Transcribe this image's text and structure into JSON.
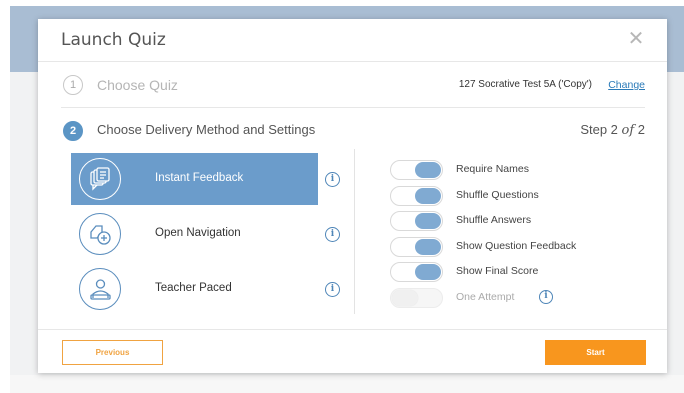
{
  "modal": {
    "title": "Launch Quiz",
    "close_icon": "close-icon"
  },
  "step1": {
    "number": "1",
    "label": "Choose Quiz",
    "quiz_name": "127 Socrative Test 5A ('Copy')",
    "change_link": "Change"
  },
  "step2": {
    "number": "2",
    "label": "Choose Delivery Method and Settings",
    "step_prefix": "Step 2 ",
    "step_of": "of",
    "step_suffix": " 2"
  },
  "methods": [
    {
      "label": "Instant Feedback",
      "icon": "instant-feedback-icon",
      "selected": true
    },
    {
      "label": "Open Navigation",
      "icon": "open-navigation-icon",
      "selected": false
    },
    {
      "label": "Teacher Paced",
      "icon": "teacher-paced-icon",
      "selected": false
    }
  ],
  "info_glyph": "i",
  "settings": [
    {
      "label": "Require Names",
      "on": true
    },
    {
      "label": "Shuffle Questions",
      "on": true
    },
    {
      "label": "Shuffle Answers",
      "on": true
    },
    {
      "label": "Show Question Feedback",
      "on": true
    },
    {
      "label": "Show Final Score",
      "on": true
    },
    {
      "label": "One Attempt",
      "on": false
    }
  ],
  "footer": {
    "previous_label": "Previous",
    "start_label": "Start"
  },
  "colors": {
    "accent_blue": "#6b9ccb",
    "toggle_blue": "#80aad2",
    "start_orange": "#f8961e",
    "link_blue": "#2a7ab8"
  }
}
